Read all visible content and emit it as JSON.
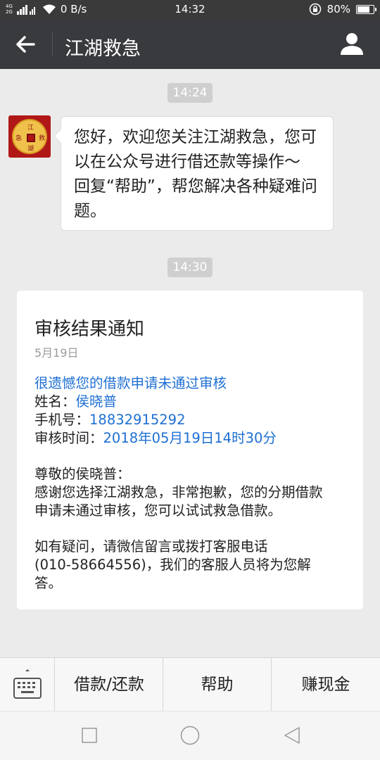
{
  "status_bar": {
    "signal_1": "4G",
    "signal_2": "2G",
    "speed": "0 B/s",
    "time": "14:32",
    "battery_percent_label": "80%",
    "battery_level": 0.8
  },
  "header": {
    "title": "江湖救急",
    "back_icon": "back-arrow-icon",
    "profile_icon": "user-icon"
  },
  "chat": {
    "time_1": "14:24",
    "avatar": {
      "chars": [
        "江",
        "湖",
        "救",
        "急"
      ]
    },
    "message_lines": [
      "您好，欢迎您关注江湖救急，您可",
      "以在公众号进行借还款等操作～",
      "回复“帮助”，帮您解决各种疑难问",
      "题。"
    ],
    "time_2": "14:30",
    "card": {
      "title": "审核结果通知",
      "date": "5月19日",
      "headline": "很遗憾您的借款申请未通过审核",
      "name_label": "姓名：",
      "name_value": "侯晓普",
      "phone_label": "手机号：",
      "phone_value": "18832915292",
      "time_label": "审核时间：",
      "time_value": "2018年05月19日14时30分",
      "greeting": "尊敬的侯晓普：",
      "body_lines": [
        "感谢您选择江湖救急，非常抱歉，您的分期借款",
        "申请未通过审核，您可以试试救急借款。"
      ],
      "contact_lines": [
        "如有疑问，请微信留言或拨打客服电话",
        "(010-58664556)，我们的客服人员将为您解",
        "答。"
      ]
    }
  },
  "menu": {
    "keyboard_icon": "keyboard-icon",
    "items": [
      "借款/还款",
      "帮助",
      "赚现金"
    ]
  },
  "system_nav": [
    "square-icon",
    "circle-icon",
    "triangle-back-icon"
  ],
  "colors": {
    "link_blue": "#1e6fd3",
    "nav_bg": "#393a3e",
    "chat_bg": "#ebebeb"
  }
}
